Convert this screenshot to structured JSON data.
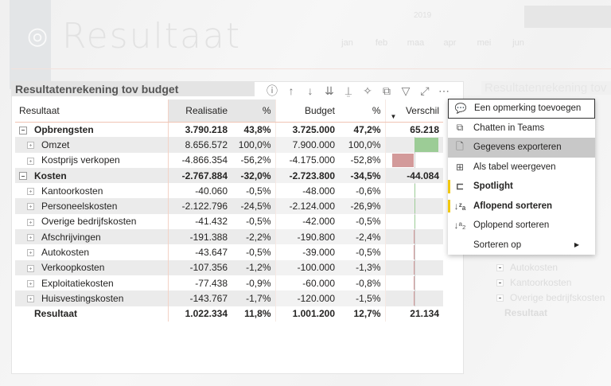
{
  "background": {
    "title": "Resultaat",
    "year": "2019",
    "months": [
      "jan",
      "feb",
      "maa",
      "apr",
      "mei",
      "jun"
    ],
    "ghost_title": "Resultatenrekening tov",
    "ghost_rows": [
      "Autokosten",
      "Kantoorkosten",
      "Overige bedrijfskosten",
      "Resultaat"
    ]
  },
  "visual": {
    "title": "Resultatenrekening tov budget",
    "toolbar": [
      "help-icon",
      "drill-up-icon",
      "drill-down-icon",
      "expand-all-icon",
      "hierarchy-icon",
      "pin-icon",
      "copy-icon",
      "filter-icon",
      "focus-mode-icon",
      "more-options-icon"
    ],
    "columns": [
      "Resultaat",
      "Realisatie",
      "%",
      "Budget",
      "%",
      "Verschil"
    ],
    "rows": [
      {
        "label": "Opbrengsten",
        "type": "group",
        "realisatie": "3.790.218",
        "pct1": "43,8%",
        "budget": "3.725.000",
        "pct2": "47,2%",
        "verschil": "65.218"
      },
      {
        "label": "Omzet",
        "type": "item",
        "realisatie": "8.656.572",
        "pct1": "100,0%",
        "budget": "7.900.000",
        "pct2": "100,0%",
        "verschil_bar": 756572
      },
      {
        "label": "Kostprijs verkopen",
        "type": "item",
        "realisatie": "-4.866.354",
        "pct1": "-56,2%",
        "budget": "-4.175.000",
        "pct2": "-52,8%",
        "verschil_bar": -691354
      },
      {
        "label": "Kosten",
        "type": "group",
        "realisatie": "-2.767.884",
        "pct1": "-32,0%",
        "budget": "-2.723.800",
        "pct2": "-34,5%",
        "verschil": "-44.084"
      },
      {
        "label": "Kantoorkosten",
        "type": "item",
        "realisatie": "-40.060",
        "pct1": "-0,5%",
        "budget": "-48.000",
        "pct2": "-0,6%",
        "verschil_bar": 7940
      },
      {
        "label": "Personeelskosten",
        "type": "item",
        "realisatie": "-2.122.796",
        "pct1": "-24,5%",
        "budget": "-2.124.000",
        "pct2": "-26,9%",
        "verschil_bar": 1204
      },
      {
        "label": "Overige bedrijfskosten",
        "type": "item",
        "realisatie": "-41.432",
        "pct1": "-0,5%",
        "budget": "-42.000",
        "pct2": "-0,5%",
        "verschil_bar": 568
      },
      {
        "label": "Afschrijvingen",
        "type": "item",
        "realisatie": "-191.388",
        "pct1": "-2,2%",
        "budget": "-190.800",
        "pct2": "-2,4%",
        "verschil_bar": -588
      },
      {
        "label": "Autokosten",
        "type": "item",
        "realisatie": "-43.647",
        "pct1": "-0,5%",
        "budget": "-39.000",
        "pct2": "-0,5%",
        "verschil_bar": -4647
      },
      {
        "label": "Verkoopkosten",
        "type": "item",
        "realisatie": "-107.356",
        "pct1": "-1,2%",
        "budget": "-100.000",
        "pct2": "-1,3%",
        "verschil_bar": -7356
      },
      {
        "label": "Exploitatiekosten",
        "type": "item",
        "realisatie": "-77.438",
        "pct1": "-0,9%",
        "budget": "-60.000",
        "pct2": "-0,8%",
        "verschil_bar": -17438
      },
      {
        "label": "Huisvestingskosten",
        "type": "item",
        "realisatie": "-143.767",
        "pct1": "-1,7%",
        "budget": "-120.000",
        "pct2": "-1,5%",
        "verschil_bar": -23767
      },
      {
        "label": "Resultaat",
        "type": "total",
        "realisatie": "1.022.334",
        "pct1": "11,8%",
        "budget": "1.001.200",
        "pct2": "12,7%",
        "verschil": "21.134"
      }
    ]
  },
  "colors": {
    "positive": "#9ccc96",
    "negative": "#d39a9a",
    "marker": "#f2c811"
  },
  "menu": {
    "items": [
      {
        "label": "Een opmerking toevoegen",
        "icon": "comment-icon",
        "glyph": "💬"
      },
      {
        "label": "Chatten in Teams",
        "icon": "teams-icon",
        "glyph": "⧉"
      },
      {
        "label": "Gegevens exporteren",
        "icon": "export-icon",
        "glyph": "🗋"
      },
      {
        "label": "Als tabel weergeven",
        "icon": "table-view-icon",
        "glyph": "⊞"
      },
      {
        "label": "Spotlight",
        "icon": "spotlight-icon",
        "glyph": "⊏"
      },
      {
        "label": "Aflopend sorteren",
        "icon": "sort-descending-icon",
        "glyph": "↓ᶻₐ"
      },
      {
        "label": "Oplopend sorteren",
        "icon": "sort-ascending-icon",
        "glyph": "↓ᵃ₂"
      },
      {
        "label": "Sorteren op",
        "icon": "",
        "glyph": ""
      }
    ]
  }
}
